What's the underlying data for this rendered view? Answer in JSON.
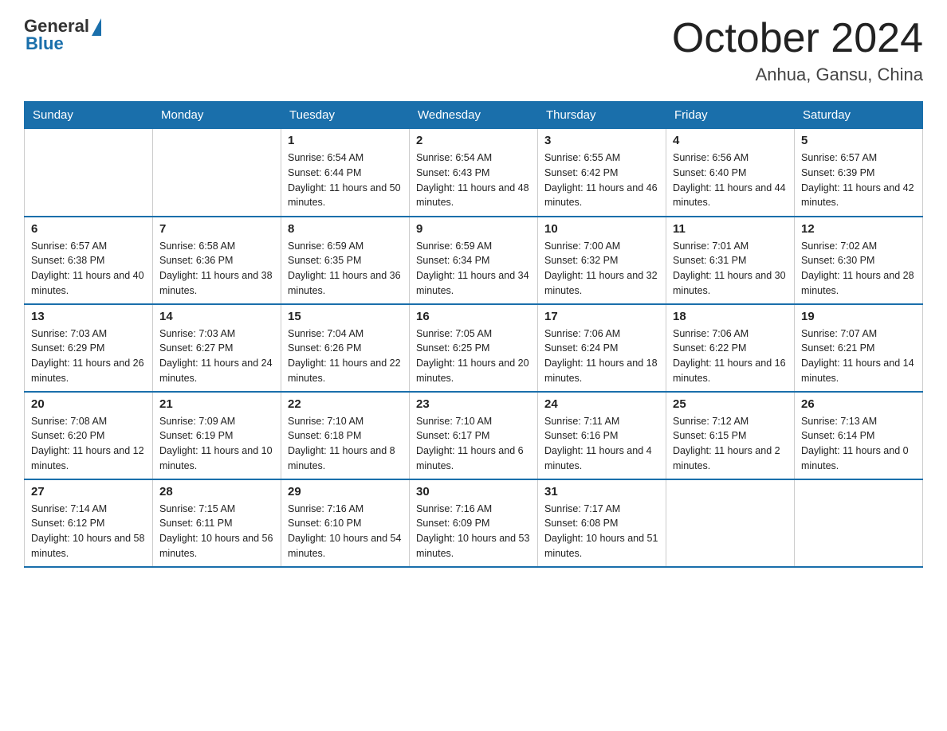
{
  "header": {
    "logo_general": "General",
    "logo_blue": "Blue",
    "title": "October 2024",
    "location": "Anhua, Gansu, China"
  },
  "days_of_week": [
    "Sunday",
    "Monday",
    "Tuesday",
    "Wednesday",
    "Thursday",
    "Friday",
    "Saturday"
  ],
  "weeks": [
    [
      {
        "day": "",
        "sunrise": "",
        "sunset": "",
        "daylight": ""
      },
      {
        "day": "",
        "sunrise": "",
        "sunset": "",
        "daylight": ""
      },
      {
        "day": "1",
        "sunrise": "Sunrise: 6:54 AM",
        "sunset": "Sunset: 6:44 PM",
        "daylight": "Daylight: 11 hours and 50 minutes."
      },
      {
        "day": "2",
        "sunrise": "Sunrise: 6:54 AM",
        "sunset": "Sunset: 6:43 PM",
        "daylight": "Daylight: 11 hours and 48 minutes."
      },
      {
        "day": "3",
        "sunrise": "Sunrise: 6:55 AM",
        "sunset": "Sunset: 6:42 PM",
        "daylight": "Daylight: 11 hours and 46 minutes."
      },
      {
        "day": "4",
        "sunrise": "Sunrise: 6:56 AM",
        "sunset": "Sunset: 6:40 PM",
        "daylight": "Daylight: 11 hours and 44 minutes."
      },
      {
        "day": "5",
        "sunrise": "Sunrise: 6:57 AM",
        "sunset": "Sunset: 6:39 PM",
        "daylight": "Daylight: 11 hours and 42 minutes."
      }
    ],
    [
      {
        "day": "6",
        "sunrise": "Sunrise: 6:57 AM",
        "sunset": "Sunset: 6:38 PM",
        "daylight": "Daylight: 11 hours and 40 minutes."
      },
      {
        "day": "7",
        "sunrise": "Sunrise: 6:58 AM",
        "sunset": "Sunset: 6:36 PM",
        "daylight": "Daylight: 11 hours and 38 minutes."
      },
      {
        "day": "8",
        "sunrise": "Sunrise: 6:59 AM",
        "sunset": "Sunset: 6:35 PM",
        "daylight": "Daylight: 11 hours and 36 minutes."
      },
      {
        "day": "9",
        "sunrise": "Sunrise: 6:59 AM",
        "sunset": "Sunset: 6:34 PM",
        "daylight": "Daylight: 11 hours and 34 minutes."
      },
      {
        "day": "10",
        "sunrise": "Sunrise: 7:00 AM",
        "sunset": "Sunset: 6:32 PM",
        "daylight": "Daylight: 11 hours and 32 minutes."
      },
      {
        "day": "11",
        "sunrise": "Sunrise: 7:01 AM",
        "sunset": "Sunset: 6:31 PM",
        "daylight": "Daylight: 11 hours and 30 minutes."
      },
      {
        "day": "12",
        "sunrise": "Sunrise: 7:02 AM",
        "sunset": "Sunset: 6:30 PM",
        "daylight": "Daylight: 11 hours and 28 minutes."
      }
    ],
    [
      {
        "day": "13",
        "sunrise": "Sunrise: 7:03 AM",
        "sunset": "Sunset: 6:29 PM",
        "daylight": "Daylight: 11 hours and 26 minutes."
      },
      {
        "day": "14",
        "sunrise": "Sunrise: 7:03 AM",
        "sunset": "Sunset: 6:27 PM",
        "daylight": "Daylight: 11 hours and 24 minutes."
      },
      {
        "day": "15",
        "sunrise": "Sunrise: 7:04 AM",
        "sunset": "Sunset: 6:26 PM",
        "daylight": "Daylight: 11 hours and 22 minutes."
      },
      {
        "day": "16",
        "sunrise": "Sunrise: 7:05 AM",
        "sunset": "Sunset: 6:25 PM",
        "daylight": "Daylight: 11 hours and 20 minutes."
      },
      {
        "day": "17",
        "sunrise": "Sunrise: 7:06 AM",
        "sunset": "Sunset: 6:24 PM",
        "daylight": "Daylight: 11 hours and 18 minutes."
      },
      {
        "day": "18",
        "sunrise": "Sunrise: 7:06 AM",
        "sunset": "Sunset: 6:22 PM",
        "daylight": "Daylight: 11 hours and 16 minutes."
      },
      {
        "day": "19",
        "sunrise": "Sunrise: 7:07 AM",
        "sunset": "Sunset: 6:21 PM",
        "daylight": "Daylight: 11 hours and 14 minutes."
      }
    ],
    [
      {
        "day": "20",
        "sunrise": "Sunrise: 7:08 AM",
        "sunset": "Sunset: 6:20 PM",
        "daylight": "Daylight: 11 hours and 12 minutes."
      },
      {
        "day": "21",
        "sunrise": "Sunrise: 7:09 AM",
        "sunset": "Sunset: 6:19 PM",
        "daylight": "Daylight: 11 hours and 10 minutes."
      },
      {
        "day": "22",
        "sunrise": "Sunrise: 7:10 AM",
        "sunset": "Sunset: 6:18 PM",
        "daylight": "Daylight: 11 hours and 8 minutes."
      },
      {
        "day": "23",
        "sunrise": "Sunrise: 7:10 AM",
        "sunset": "Sunset: 6:17 PM",
        "daylight": "Daylight: 11 hours and 6 minutes."
      },
      {
        "day": "24",
        "sunrise": "Sunrise: 7:11 AM",
        "sunset": "Sunset: 6:16 PM",
        "daylight": "Daylight: 11 hours and 4 minutes."
      },
      {
        "day": "25",
        "sunrise": "Sunrise: 7:12 AM",
        "sunset": "Sunset: 6:15 PM",
        "daylight": "Daylight: 11 hours and 2 minutes."
      },
      {
        "day": "26",
        "sunrise": "Sunrise: 7:13 AM",
        "sunset": "Sunset: 6:14 PM",
        "daylight": "Daylight: 11 hours and 0 minutes."
      }
    ],
    [
      {
        "day": "27",
        "sunrise": "Sunrise: 7:14 AM",
        "sunset": "Sunset: 6:12 PM",
        "daylight": "Daylight: 10 hours and 58 minutes."
      },
      {
        "day": "28",
        "sunrise": "Sunrise: 7:15 AM",
        "sunset": "Sunset: 6:11 PM",
        "daylight": "Daylight: 10 hours and 56 minutes."
      },
      {
        "day": "29",
        "sunrise": "Sunrise: 7:16 AM",
        "sunset": "Sunset: 6:10 PM",
        "daylight": "Daylight: 10 hours and 54 minutes."
      },
      {
        "day": "30",
        "sunrise": "Sunrise: 7:16 AM",
        "sunset": "Sunset: 6:09 PM",
        "daylight": "Daylight: 10 hours and 53 minutes."
      },
      {
        "day": "31",
        "sunrise": "Sunrise: 7:17 AM",
        "sunset": "Sunset: 6:08 PM",
        "daylight": "Daylight: 10 hours and 51 minutes."
      },
      {
        "day": "",
        "sunrise": "",
        "sunset": "",
        "daylight": ""
      },
      {
        "day": "",
        "sunrise": "",
        "sunset": "",
        "daylight": ""
      }
    ]
  ]
}
